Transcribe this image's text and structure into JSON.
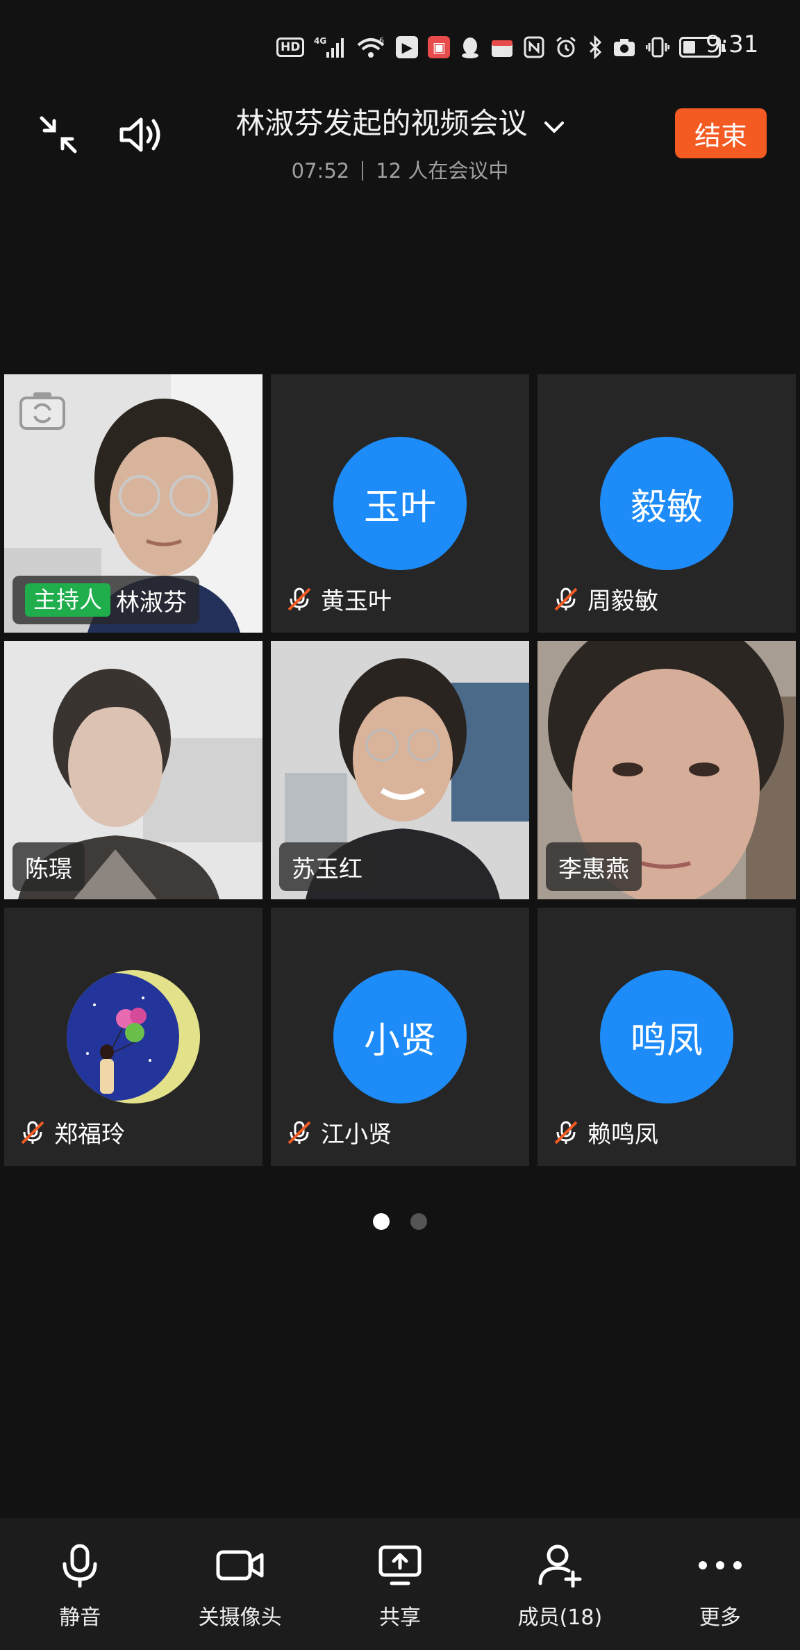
{
  "status_bar": {
    "hd_label": "HD",
    "network_label": "4G",
    "wifi_label": "6",
    "time": "9:31",
    "battery_level": 0.3
  },
  "header": {
    "meeting_title": "林淑芬发起的视频会议",
    "duration": "07:52",
    "participants_text": "12 人在会议中",
    "end_button_label": "结束"
  },
  "participants": [
    {
      "name": "林淑芬",
      "host_label": "主持人",
      "video": true
    },
    {
      "name": "黄玉叶",
      "avatar_text": "玉叶",
      "muted": true
    },
    {
      "name": "周毅敏",
      "avatar_text": "毅敏",
      "muted": true
    },
    {
      "name": "陈璟",
      "video": true
    },
    {
      "name": "苏玉红",
      "video": true
    },
    {
      "name": "李惠燕",
      "video": true
    },
    {
      "name": "郑福玲",
      "avatar_type": "image",
      "muted": true
    },
    {
      "name": "江小贤",
      "avatar_text": "小贤",
      "muted": true
    },
    {
      "name": "赖鸣凤",
      "avatar_text": "鸣凤",
      "muted": true
    }
  ],
  "pager": {
    "current": 1,
    "total": 2
  },
  "toolbar": {
    "mute_label": "静音",
    "camera_label": "关摄像头",
    "share_label": "共享",
    "members_label": "成员(18)",
    "more_label": "更多"
  },
  "colors": {
    "background": "#121212",
    "tile": "#262626",
    "avatar_blue": "#1d8cf8",
    "end_button": "#f35b23",
    "host_badge": "#1fae4b",
    "muted_slash": "#f35b23"
  }
}
